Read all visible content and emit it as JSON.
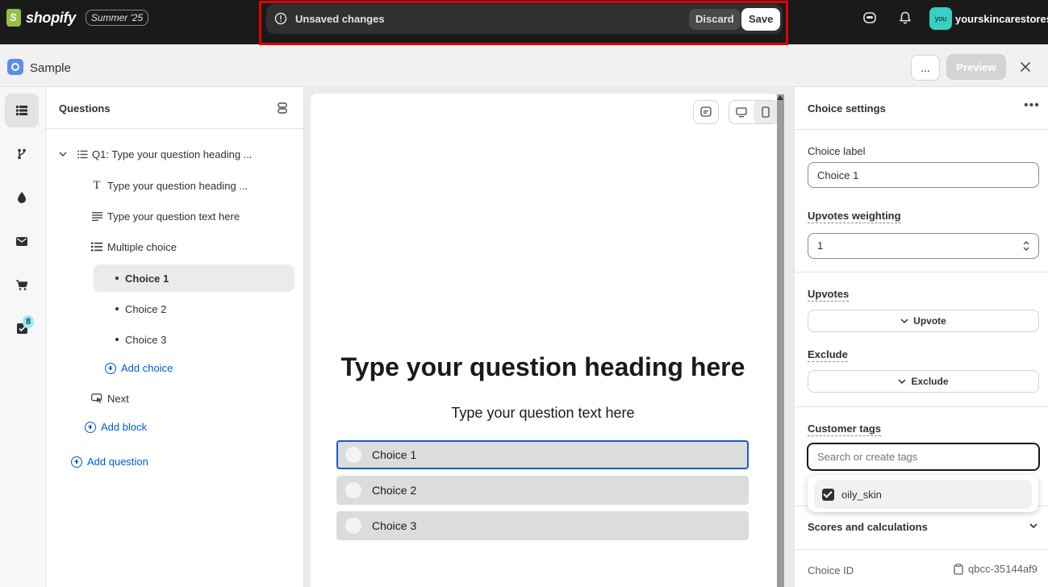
{
  "topbar": {
    "brand": "shopify",
    "edition": "Summer '25",
    "unsaved_text": "Unsaved changes",
    "discard_label": "Discard",
    "save_label": "Save",
    "avatar_initials": "you",
    "store_name": "yourskincarestores"
  },
  "app": {
    "title": "Sample",
    "more_label": "...",
    "preview_label": "Preview"
  },
  "rail": {
    "badge_count": "8",
    "items": [
      "list-icon",
      "branch-icon",
      "drop-icon",
      "mail-icon",
      "cart-icon",
      "checklist-icon"
    ]
  },
  "questions": {
    "title": "Questions",
    "question_label": "Q1: Type your question heading ...",
    "heading_block": "Type your question heading ...",
    "text_block": "Type your question text here",
    "multiple_choice": "Multiple choice",
    "choices": [
      "Choice 1",
      "Choice 2",
      "Choice 3"
    ],
    "add_choice": "Add choice",
    "next": "Next",
    "add_block": "Add block",
    "add_question": "Add question"
  },
  "preview": {
    "heading": "Type your question heading here",
    "text": "Type your question text here",
    "choices": [
      "Choice 1",
      "Choice 2",
      "Choice 3"
    ]
  },
  "settings": {
    "title": "Choice settings",
    "choice_label_label": "Choice label",
    "choice_label_value": "Choice 1",
    "upvotes_weighting_label": "Upvotes weighting",
    "upvotes_weighting_value": "1",
    "upvotes_label": "Upvotes",
    "upvote_button": "Upvote",
    "exclude_label": "Exclude",
    "exclude_button": "Exclude",
    "customer_tags_label": "Customer tags",
    "tags_placeholder": "Search or create tags",
    "tag_option": "oily_skin",
    "scores_title": "Scores and calculations",
    "choice_id_label": "Choice ID",
    "choice_id_value": "qbcc-35144af9"
  },
  "colors": {
    "accent_link": "#005bd3",
    "highlight_frame": "#e00000",
    "selected_choice_border": "#1a5bc4"
  }
}
